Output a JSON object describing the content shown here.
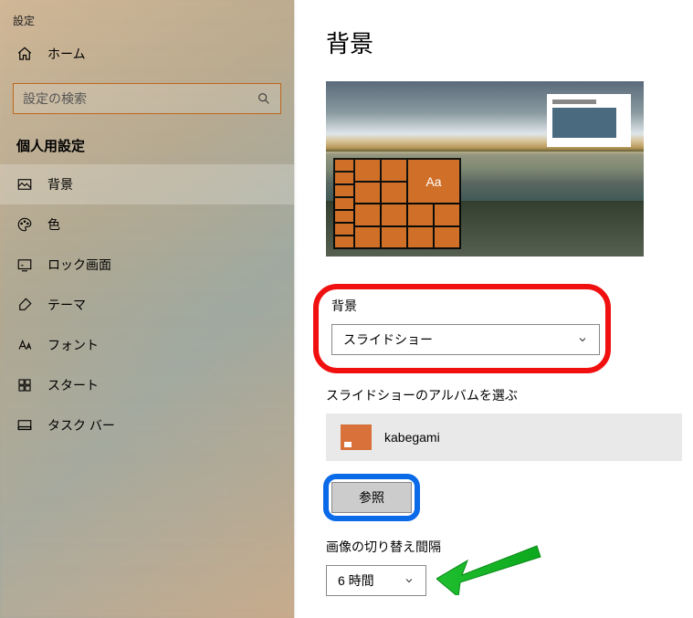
{
  "app": {
    "title": "設定"
  },
  "sidebar": {
    "home": "ホーム",
    "search_placeholder": "設定の検索",
    "section": "個人用設定",
    "items": [
      {
        "label": "背景"
      },
      {
        "label": "色"
      },
      {
        "label": "ロック画面"
      },
      {
        "label": "テーマ"
      },
      {
        "label": "フォント"
      },
      {
        "label": "スタート"
      },
      {
        "label": "タスク バー"
      }
    ]
  },
  "main": {
    "title": "背景",
    "preview_tile_text": "Aa",
    "background_label": "背景",
    "background_value": "スライドショー",
    "album_label": "スライドショーのアルバムを選ぶ",
    "album_name": "kabegami",
    "browse_button": "参照",
    "interval_label": "画像の切り替え間隔",
    "interval_value": "6 時間"
  }
}
